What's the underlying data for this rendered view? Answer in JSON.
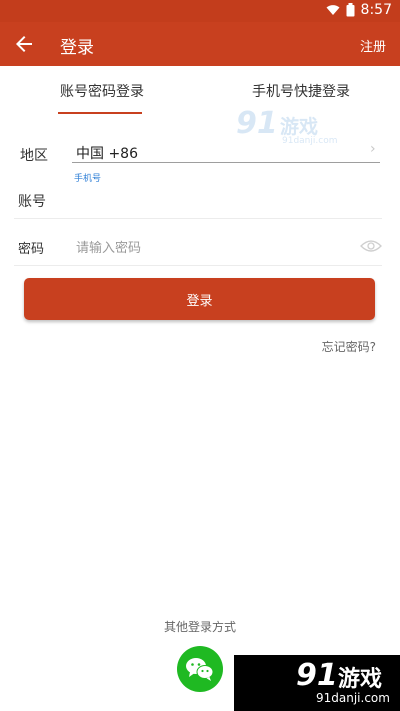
{
  "status_bar": {
    "time": "8:57",
    "icons": [
      "wifi-icon",
      "battery-icon"
    ]
  },
  "app_bar": {
    "title": "登录",
    "register_label": "注册",
    "back_icon": "arrow-left-icon"
  },
  "tabs": [
    {
      "label": "账号密码登录",
      "active": true
    },
    {
      "label": "手机号快捷登录",
      "active": false
    }
  ],
  "form": {
    "region_label": "地区",
    "region_value": "中国 +86",
    "phone_hint": "手机号",
    "account_label": "账号",
    "account_value": "",
    "password_label": "密码",
    "password_placeholder": "请输入密码",
    "login_button": "登录",
    "forgot_password": "忘记密码?"
  },
  "other_login": {
    "label": "其他登录方式",
    "wechat_icon": "wechat-icon"
  },
  "watermark": {
    "number": "91",
    "text": "游戏",
    "url": "91danji.com"
  },
  "colors": {
    "brand": "#c8401f",
    "wechat": "#1fb922",
    "link": "#2f7fd6"
  }
}
